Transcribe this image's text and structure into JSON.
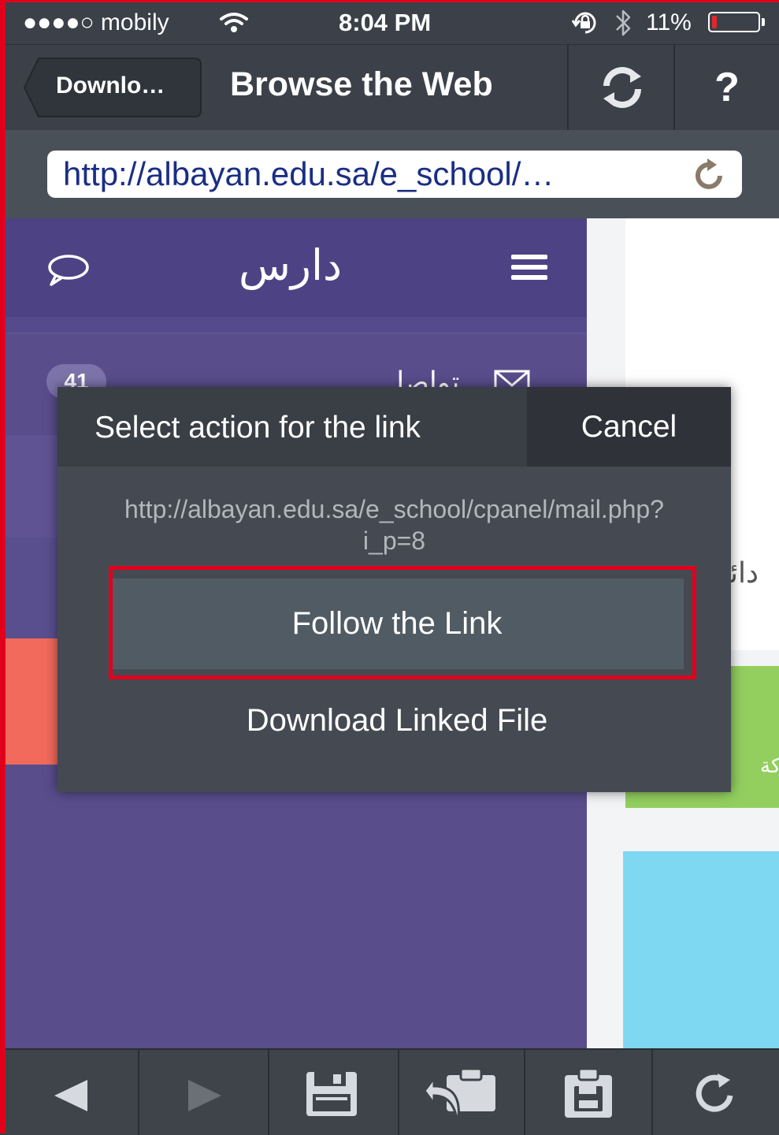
{
  "status_bar": {
    "carrier": "●●●●○ mobily",
    "time": "8:04 PM",
    "battery_percent": "11%",
    "battery_level": 0.11
  },
  "nav": {
    "back_label": "Downlo…",
    "title": "Browse the Web",
    "help_label": "?"
  },
  "url_bar": {
    "url": "http://albayan.edu.sa/e_school/…"
  },
  "web_page": {
    "brand": "دارس",
    "badge_count": "41",
    "menu_label": "تواصل",
    "right_text": "دائي",
    "right_green_text": "كة"
  },
  "action_sheet": {
    "title": "Select action for the link",
    "cancel_label": "Cancel",
    "link_url": "http://albayan.edu.sa/e_school/cpanel/mail.php?i_p=8",
    "follow_label": "Follow the Link",
    "download_label": "Download Linked File"
  },
  "toolbar": {
    "icons": [
      "back-arrow-icon",
      "forward-arrow-icon",
      "save-icon",
      "share-clipboard-icon",
      "clipboard-save-icon",
      "reload-icon"
    ]
  },
  "colors": {
    "chrome": "#3b4049",
    "purple": "#594d8c",
    "highlight": "#e1001b",
    "url_text": "#1a2e84"
  }
}
